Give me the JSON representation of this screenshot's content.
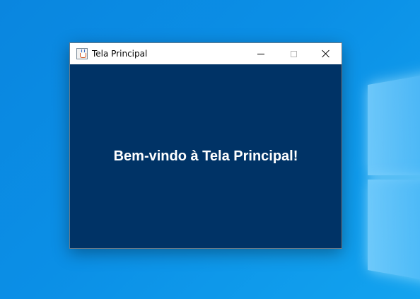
{
  "window": {
    "title": "Tela Principal",
    "app_icon": "java-cup-icon",
    "controls": [
      "minimize-icon",
      "maximize-icon",
      "close-icon"
    ]
  },
  "main": {
    "welcome_text": "Bem-vindo à Tela Principal!",
    "background_color": "#003366",
    "text_color": "#ffffff"
  },
  "desktop": {
    "wallpaper": "windows-10-blue",
    "accent": "#0a86df"
  }
}
